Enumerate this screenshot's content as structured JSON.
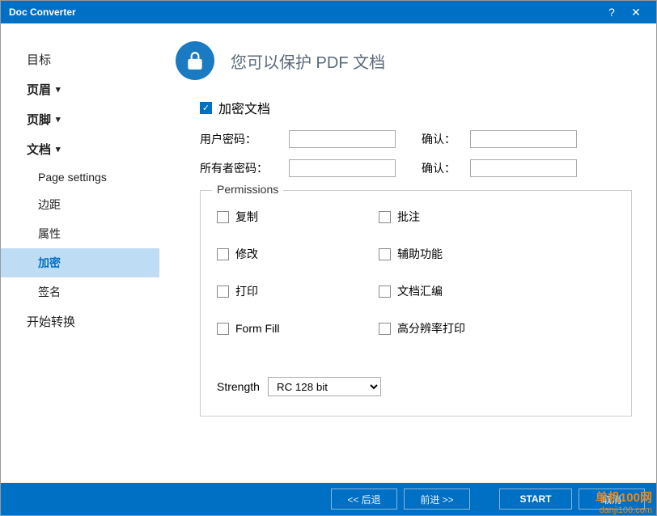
{
  "window": {
    "title": "Doc Converter"
  },
  "sidebar": {
    "items": [
      {
        "label": "目标",
        "bold": false
      },
      {
        "label": "页眉",
        "bold": true,
        "expand": true
      },
      {
        "label": "页脚",
        "bold": true,
        "expand": true
      },
      {
        "label": "文档",
        "bold": true,
        "expand": true
      }
    ],
    "subitems": [
      {
        "label": "Page settings"
      },
      {
        "label": "边距"
      },
      {
        "label": "属性"
      },
      {
        "label": "加密"
      },
      {
        "label": "签名"
      }
    ],
    "last": {
      "label": "开始转换"
    }
  },
  "page": {
    "title": "您可以保护 PDF 文档"
  },
  "encrypt": {
    "encrypt_doc": "加密文档",
    "user_pw": "用户密码：",
    "owner_pw": "所有者密码：",
    "confirm": "确认："
  },
  "permissions": {
    "legend": "Permissions",
    "items": [
      "复制",
      "批注",
      "修改",
      "辅助功能",
      "打印",
      "文档汇编",
      "Form Fill",
      "高分辨率打印"
    ]
  },
  "strength": {
    "label": "Strength",
    "value": "RC 128 bit"
  },
  "footer": {
    "back": "<<  后退",
    "next": "前进  >>",
    "start": "START",
    "cancel": "取消"
  },
  "watermark": {
    "l1": "单机100网",
    "l2": "danji100.com"
  }
}
